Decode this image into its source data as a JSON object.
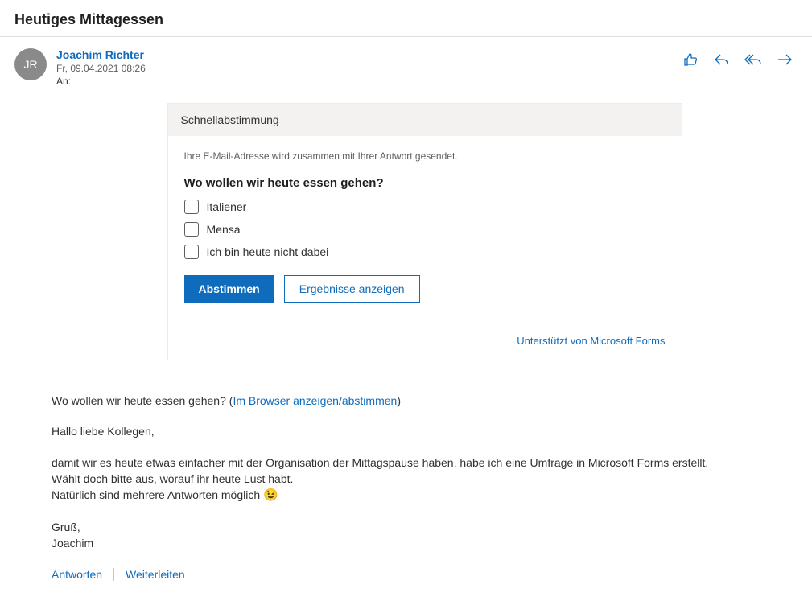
{
  "subject": "Heutiges Mittagessen",
  "sender": {
    "initials": "JR",
    "name": "Joachim Richter",
    "date": "Fr, 09.04.2021 08:26",
    "to_label": "An:"
  },
  "poll": {
    "header": "Schnellabstimmung",
    "notice": "Ihre E-Mail-Adresse wird zusammen mit Ihrer Antwort gesendet.",
    "question": "Wo wollen wir heute essen gehen?",
    "options": [
      "Italiener",
      "Mensa",
      "Ich bin heute nicht dabei"
    ],
    "vote_label": "Abstimmen",
    "results_label": "Ergebnisse anzeigen",
    "footer": "Unterstützt von Microsoft Forms"
  },
  "body": {
    "intro_question": "Wo wollen wir heute essen gehen? (",
    "intro_link": "Im Browser anzeigen/abstimmen",
    "intro_close": ")",
    "greeting": "Hallo liebe Kollegen,",
    "line1": "damit wir es heute etwas einfacher mit der Organisation der Mittagspause haben, habe ich eine Umfrage in Microsoft Forms erstellt.",
    "line2": "Wählt doch bitte aus, worauf ihr heute Lust habt.",
    "line3_text": "Natürlich sind mehrere Antworten möglich ",
    "line3_emoji": "😉",
    "signoff1": "Gruß,",
    "signoff2": "Joachim"
  },
  "footer_actions": {
    "reply": "Antworten",
    "forward": "Weiterleiten"
  }
}
